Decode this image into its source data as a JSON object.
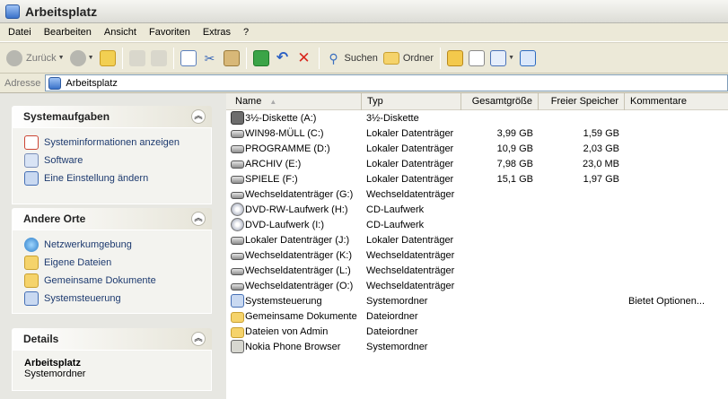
{
  "window": {
    "title": "Arbeitsplatz"
  },
  "menu": [
    "Datei",
    "Bearbeiten",
    "Ansicht",
    "Favoriten",
    "Extras",
    "?"
  ],
  "toolbar": {
    "back": "Zurück",
    "search": "Suchen",
    "folders": "Ordner"
  },
  "address": {
    "label": "Adresse",
    "value": "Arbeitsplatz"
  },
  "taskpane": {
    "system": {
      "title": "Systemaufgaben",
      "items": [
        "Systeminformationen anzeigen",
        "Software",
        "Eine Einstellung ändern"
      ]
    },
    "other": {
      "title": "Andere Orte",
      "items": [
        "Netzwerkumgebung",
        "Eigene Dateien",
        "Gemeinsame Dokumente",
        "Systemsteuerung"
      ]
    },
    "details": {
      "title": "Details",
      "name": "Arbeitsplatz",
      "type": "Systemordner"
    }
  },
  "columns": {
    "name": "Name",
    "type": "Typ",
    "total": "Gesamtgröße",
    "free": "Freier Speicher",
    "comment": "Kommentare"
  },
  "rows": [
    {
      "icon": "floppy-icon",
      "name": "3½-Diskette (A:)",
      "type": "3½-Diskette",
      "total": "",
      "free": "",
      "comment": ""
    },
    {
      "icon": "hard-drive-icon",
      "name": "WIN98-MÜLL (C:)",
      "type": "Lokaler Datenträger",
      "total": "3,99 GB",
      "free": "1,59 GB",
      "comment": ""
    },
    {
      "icon": "hard-drive-icon",
      "name": "PROGRAMME (D:)",
      "type": "Lokaler Datenträger",
      "total": "10,9 GB",
      "free": "2,03 GB",
      "comment": ""
    },
    {
      "icon": "hard-drive-icon",
      "name": "ARCHIV (E:)",
      "type": "Lokaler Datenträger",
      "total": "7,98 GB",
      "free": "23,0 MB",
      "comment": ""
    },
    {
      "icon": "hard-drive-icon",
      "name": "SPIELE (F:)",
      "type": "Lokaler Datenträger",
      "total": "15,1 GB",
      "free": "1,97 GB",
      "comment": ""
    },
    {
      "icon": "removable-drive-icon",
      "name": "Wechseldatenträger (G:)",
      "type": "Wechseldatenträger",
      "total": "",
      "free": "",
      "comment": ""
    },
    {
      "icon": "cd-drive-icon",
      "name": "DVD-RW-Laufwerk (H:)",
      "type": "CD-Laufwerk",
      "total": "",
      "free": "",
      "comment": ""
    },
    {
      "icon": "cd-drive-icon",
      "name": "DVD-Laufwerk (I:)",
      "type": "CD-Laufwerk",
      "total": "",
      "free": "",
      "comment": ""
    },
    {
      "icon": "hard-drive-icon",
      "name": "Lokaler Datenträger (J:)",
      "type": "Lokaler Datenträger",
      "total": "",
      "free": "",
      "comment": ""
    },
    {
      "icon": "removable-drive-icon",
      "name": "Wechseldatenträger (K:)",
      "type": "Wechseldatenträger",
      "total": "",
      "free": "",
      "comment": ""
    },
    {
      "icon": "removable-drive-icon",
      "name": "Wechseldatenträger (L:)",
      "type": "Wechseldatenträger",
      "total": "",
      "free": "",
      "comment": ""
    },
    {
      "icon": "removable-drive-icon",
      "name": "Wechseldatenträger (O:)",
      "type": "Wechseldatenträger",
      "total": "",
      "free": "",
      "comment": ""
    },
    {
      "icon": "control-panel-icon",
      "name": "Systemsteuerung",
      "type": "Systemordner",
      "total": "",
      "free": "",
      "comment": "Bietet Optionen..."
    },
    {
      "icon": "folder-icon",
      "name": "Gemeinsame Dokumente",
      "type": "Dateiordner",
      "total": "",
      "free": "",
      "comment": ""
    },
    {
      "icon": "folder-icon",
      "name": "Dateien von Admin",
      "type": "Dateiordner",
      "total": "",
      "free": "",
      "comment": ""
    },
    {
      "icon": "phone-browser-icon",
      "name": "Nokia Phone Browser",
      "type": "Systemordner",
      "total": "",
      "free": "",
      "comment": ""
    }
  ]
}
